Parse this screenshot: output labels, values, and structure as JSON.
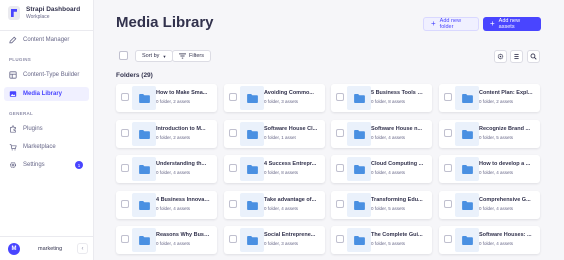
{
  "brand": {
    "title": "Strapi Dashboard",
    "subtitle": "Workplace"
  },
  "sidebar": {
    "content_manager": "Content Manager",
    "plugins_label": "PLUGINS",
    "content_type_builder": "Content-Type Builder",
    "media_library": "Media Library",
    "general_label": "GENERAL",
    "plugins": "Plugins",
    "marketplace": "Marketplace",
    "settings": "Settings",
    "settings_badge": "1"
  },
  "user": {
    "initial": "M",
    "name": "marketing"
  },
  "header": {
    "title": "Media Library",
    "add_folder": "Add new folder",
    "add_assets": "Add new assets"
  },
  "toolbar": {
    "sort_by": "Sort by",
    "filters": "Filters"
  },
  "folders": {
    "heading": "Folders (29)",
    "items": [
      {
        "name": "How to Make Sma...",
        "meta": "0 folder, 2 assets"
      },
      {
        "name": "Avoiding Commo...",
        "meta": "0 folder, 3 assets"
      },
      {
        "name": "5 Business Tools R...",
        "meta": "0 folder, 8 assets"
      },
      {
        "name": "Content Plan: Expl...",
        "meta": "0 folder, 2 assets"
      },
      {
        "name": "Introduction to M...",
        "meta": "0 folder, 2 assets"
      },
      {
        "name": "Software House Cl...",
        "meta": "0 folder, 1 asset"
      },
      {
        "name": "Software House n...",
        "meta": "0 folder, 4 assets"
      },
      {
        "name": "Recognize Brand ...",
        "meta": "0 folder, 5 assets"
      },
      {
        "name": "Understanding th...",
        "meta": "0 folder, 4 assets"
      },
      {
        "name": "4 Success Entrepr...",
        "meta": "0 folder, 8 assets"
      },
      {
        "name": "Cloud Computing ...",
        "meta": "0 folder, 4 assets"
      },
      {
        "name": "How to develop a ...",
        "meta": "0 folder, 4 assets"
      },
      {
        "name": "4 Business Innovat...",
        "meta": "0 folder, 4 assets"
      },
      {
        "name": "Take advantage of...",
        "meta": "0 folder, 4 assets"
      },
      {
        "name": "Transforming Edu...",
        "meta": "0 folder, 5 assets"
      },
      {
        "name": "Comprehensive G...",
        "meta": "0 folder, 4 assets"
      },
      {
        "name": "Reasons Why Busi...",
        "meta": "0 folder, 4 assets"
      },
      {
        "name": "Social Entreprene...",
        "meta": "0 folder, 3 assets"
      },
      {
        "name": "The Complete Gui...",
        "meta": "0 folder, 5 assets"
      },
      {
        "name": "Software Houses: ...",
        "meta": "0 folder, 4 assets"
      }
    ]
  },
  "colors": {
    "accent": "#4945ff",
    "folder": "#4a90e2",
    "folder_bg": "#eaf1fb"
  }
}
